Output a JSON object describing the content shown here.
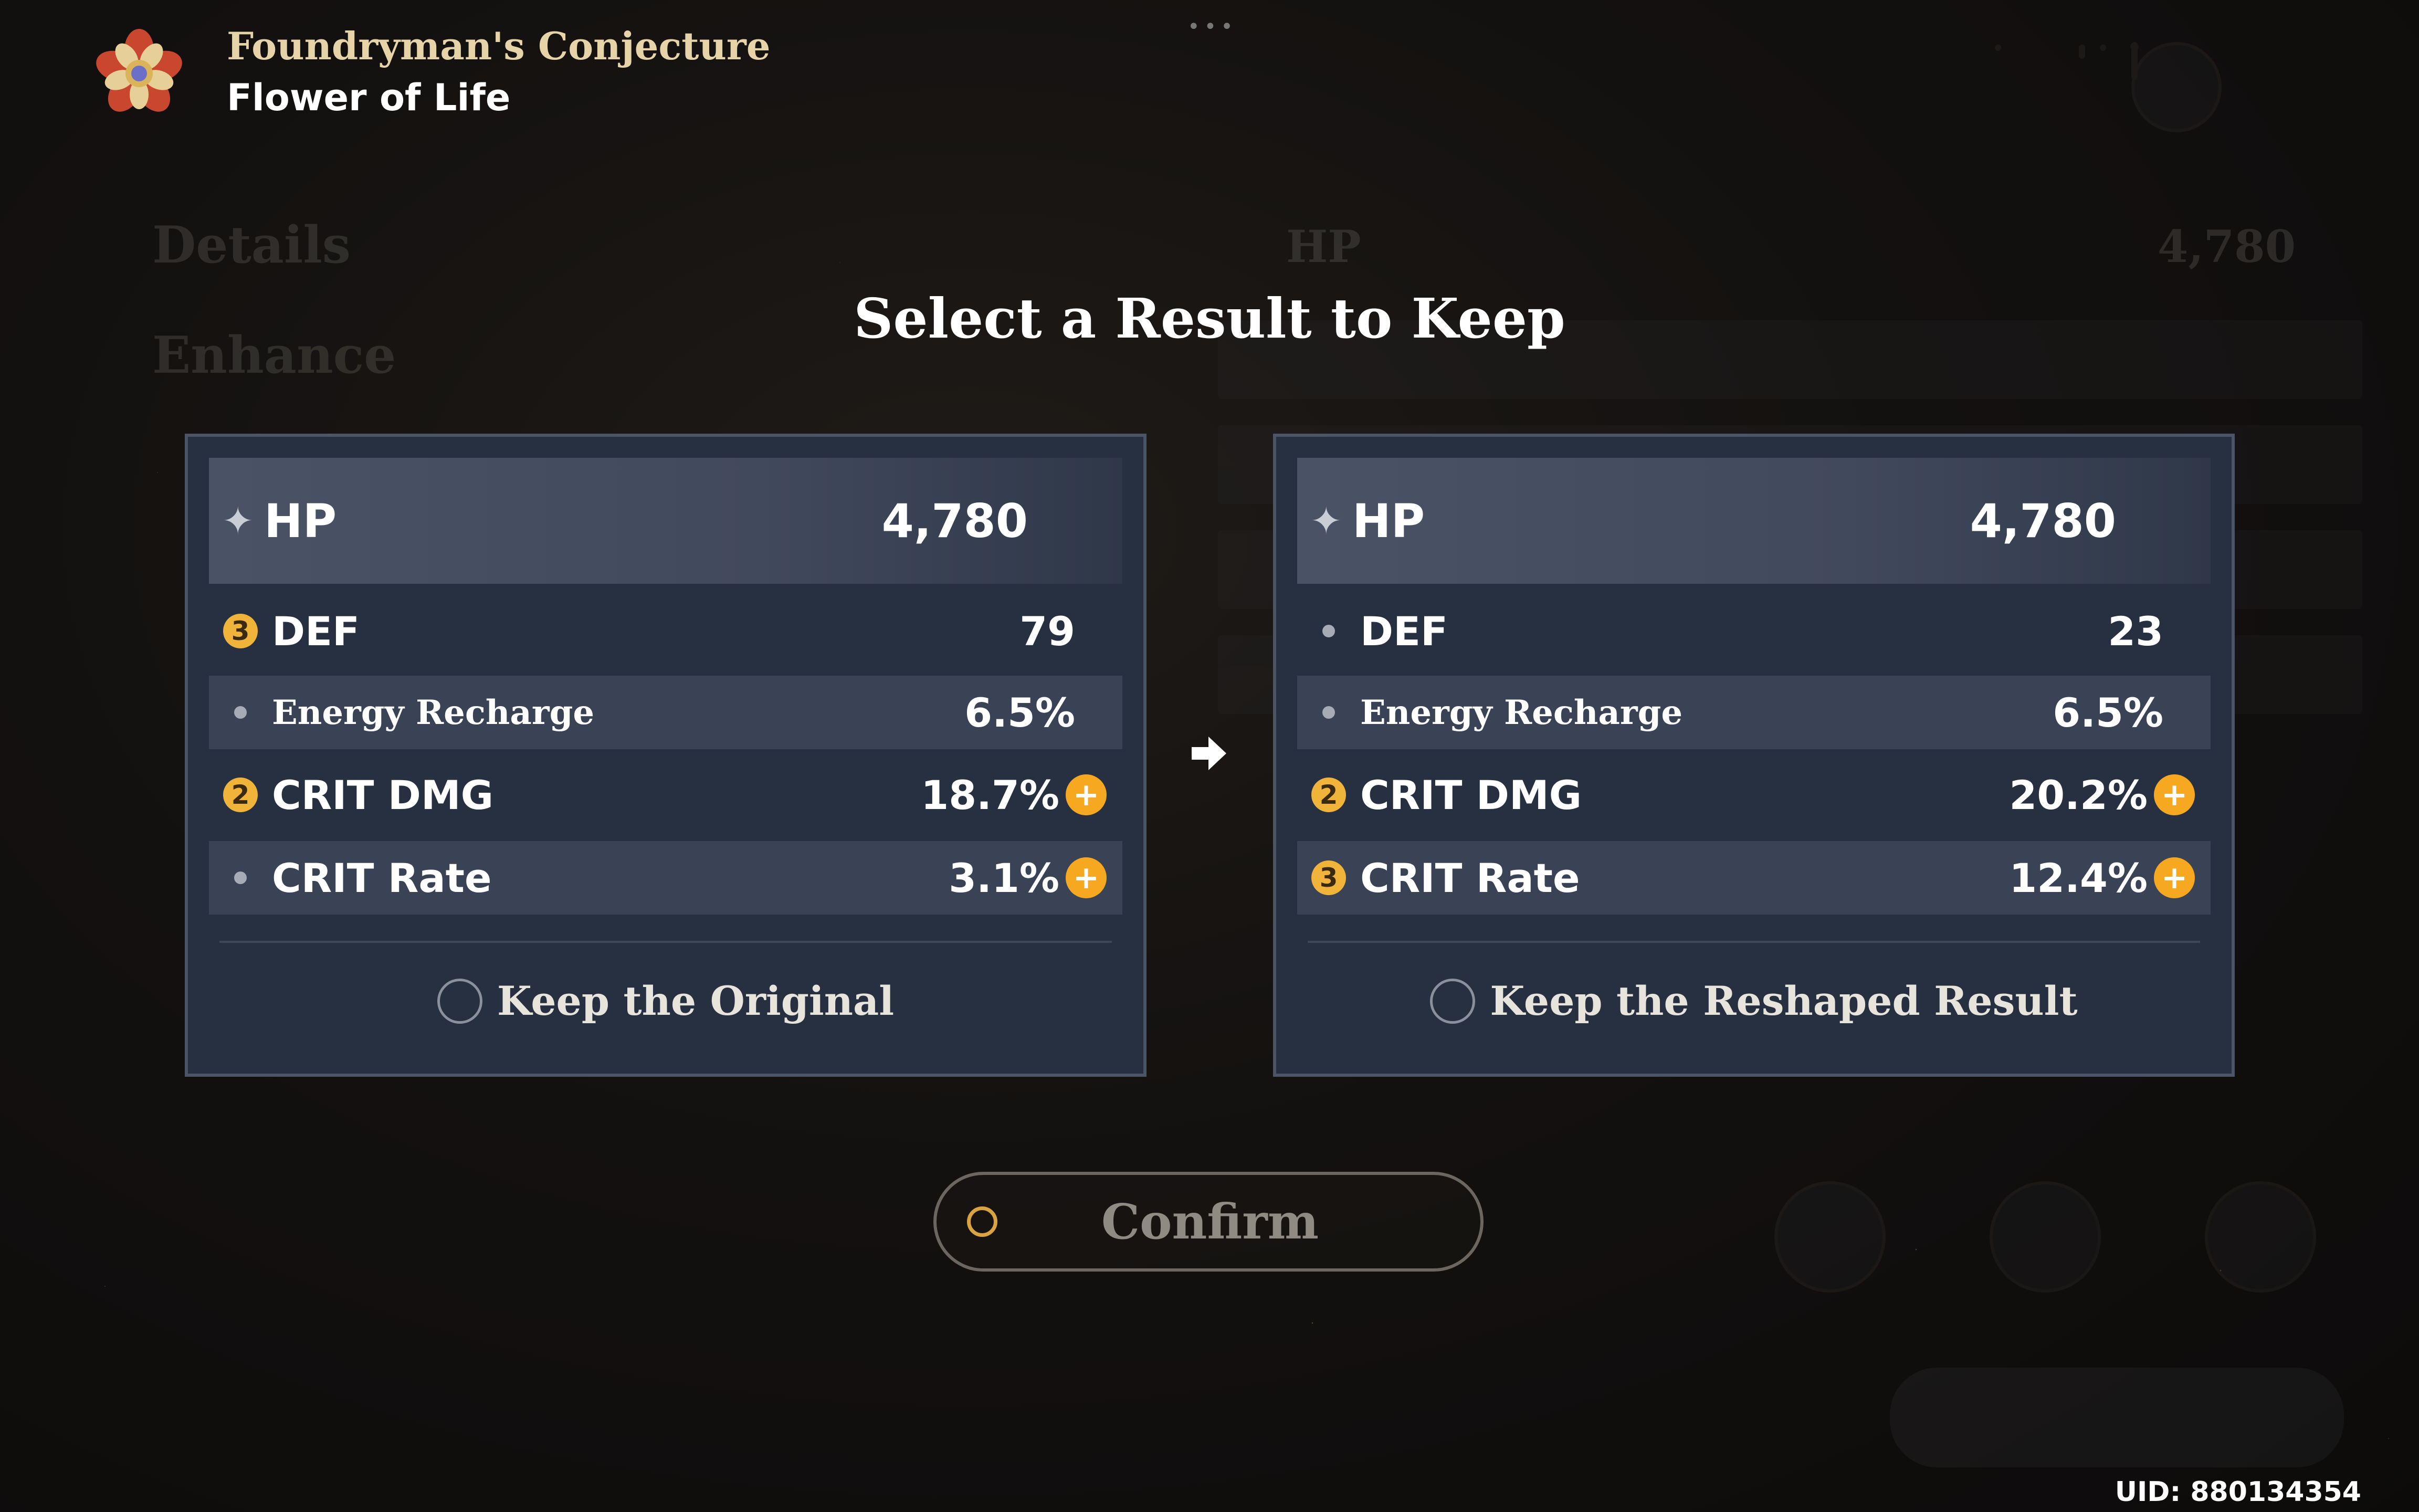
{
  "header": {
    "title": "Foundryman's Conjecture",
    "subtitle": "Flower of Life",
    "more_icon": "ellipsis-icon"
  },
  "dialog": {
    "title": "Select a Result to Keep"
  },
  "original": {
    "main_stat": {
      "name": "HP",
      "value": "4,780",
      "icon": "star-icon"
    },
    "substats": [
      {
        "name": "DEF",
        "value": "79",
        "rolls": "3",
        "highlight": false
      },
      {
        "name": "Energy Recharge",
        "value": "6.5%",
        "rolls": "",
        "highlight": false
      },
      {
        "name": "CRIT DMG",
        "value": "18.7%",
        "rolls": "2",
        "highlight": true
      },
      {
        "name": "CRIT Rate",
        "value": "3.1%",
        "rolls": "",
        "highlight": true
      }
    ],
    "keep_label": "Keep the Original"
  },
  "reshaped": {
    "main_stat": {
      "name": "HP",
      "value": "4,780",
      "icon": "star-icon"
    },
    "substats": [
      {
        "name": "DEF",
        "value": "23",
        "rolls": "",
        "highlight": false
      },
      {
        "name": "Energy Recharge",
        "value": "6.5%",
        "rolls": "",
        "highlight": false
      },
      {
        "name": "CRIT DMG",
        "value": "20.2%",
        "rolls": "2",
        "highlight": true
      },
      {
        "name": "CRIT Rate",
        "value": "12.4%",
        "rolls": "3",
        "highlight": true
      }
    ],
    "keep_label": "Keep the Reshaped Result"
  },
  "confirm": {
    "label": "Confirm"
  },
  "uid": "UID: 880134354",
  "colors": {
    "gold": "#f0b43a",
    "panel": "#273041",
    "accent_plus": "#f6a821"
  }
}
